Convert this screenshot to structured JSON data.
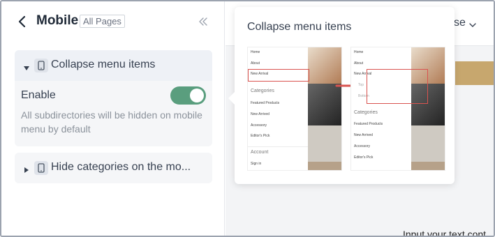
{
  "header": {
    "title": "Mobile",
    "badge": "All Pages"
  },
  "card1": {
    "title": "Collapse menu items",
    "enable_label": "Enable",
    "toggle_on": true,
    "description": "All subdirectories will be hidden on mobile menu by default"
  },
  "card2": {
    "title": "Hide categories on the mo..."
  },
  "canvas": {
    "select_text": "se",
    "input_hint": "Input your text cont"
  },
  "popover": {
    "title": "Collapse menu items",
    "left_menu": {
      "items_top": [
        "Home",
        "About",
        "New Arrival"
      ],
      "section1": "Categories",
      "items_mid": [
        "Featured Products",
        "New Arrived",
        "Accessory",
        "Editor's Pick"
      ],
      "section2": "Account",
      "items_bottom": [
        "Sign in"
      ]
    },
    "right_menu": {
      "items_top": [
        "Home",
        "About",
        "New Arrival"
      ],
      "sub_items": [
        "Top",
        "Bottom"
      ],
      "section1": "Categories",
      "items_mid": [
        "Featured Products",
        "New Arrived",
        "Accessory",
        "Editor's Pick"
      ]
    }
  },
  "colors": {
    "toggle_on": "#5a9e7e",
    "highlight": "#d9534f",
    "card_bg": "#f5f6f8"
  },
  "icons": [
    "back-chevron-icon",
    "double-chevron-left-icon",
    "caret-down-icon",
    "caret-right-icon",
    "mobile-phone-icon",
    "chevron-down-icon",
    "arrow-right-icon"
  ]
}
